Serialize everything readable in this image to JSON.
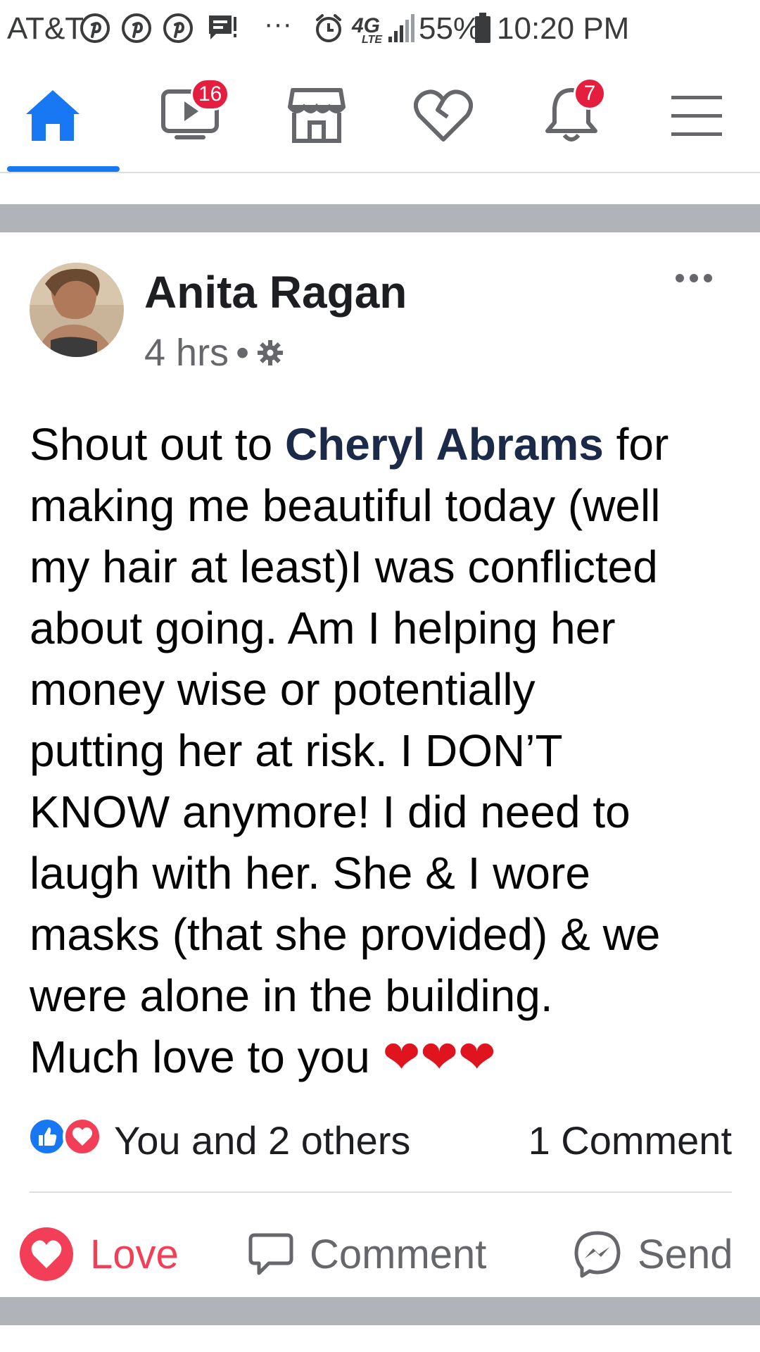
{
  "status_bar": {
    "carrier": "AT&T",
    "dots": "···",
    "network": "4G",
    "network_sub": "LTE",
    "battery": "55%",
    "time": "10:20 PM"
  },
  "nav": {
    "watch_badge": "16",
    "notifications_badge": "7",
    "accent": "#1877f2",
    "badge_color": "#e41e3f"
  },
  "post": {
    "author": "Anita Ragan",
    "time": "4 hrs",
    "separator": "•",
    "body_lines": [
      {
        "pre": "Shout out to ",
        "mention": "Cheryl Abrams",
        "post": " for"
      },
      "making me beautiful today (well",
      "my hair at least)I was conflicted",
      "about going. Am I helping her",
      "money wise or potentially",
      "putting her at risk. I DON’T",
      "KNOW anymore! I did need to",
      "laugh with her. She & I wore",
      "masks (that she provided) & we",
      "were alone in the building.",
      "Much love to you ❤❤❤"
    ],
    "reactions_text": "You and 2 others",
    "comments_text": "1 Comment"
  },
  "actions": {
    "love": "Love",
    "comment": "Comment",
    "send": "Send"
  }
}
